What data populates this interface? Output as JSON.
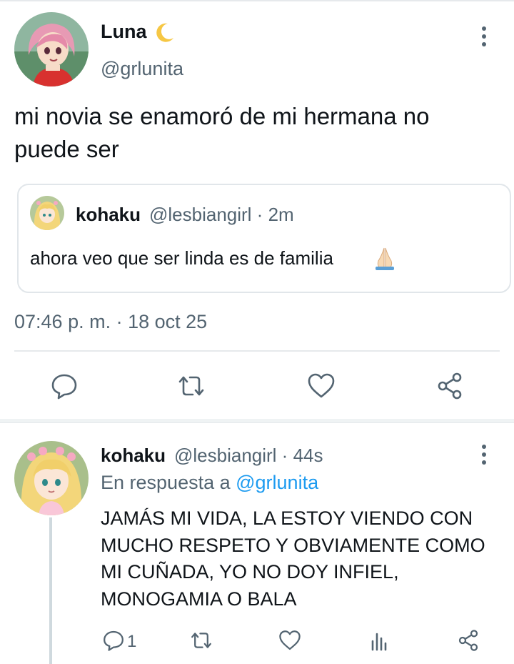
{
  "main_tweet": {
    "author_name": "Luna",
    "author_emoji": "crescent-moon-icon",
    "author_handle": "@grlunita",
    "text": "mi novia se enamoró de mi hermana no puede ser",
    "quoted": {
      "author_name": "kohaku",
      "author_handle": "@lesbiangirl · 2m",
      "text": "ahora veo que ser linda es de familia",
      "emoji": "praying-hands-icon"
    },
    "timestamp": "07:46 p. m. · 18 oct 25",
    "actions": [
      "reply-icon",
      "retweet-icon",
      "like-icon",
      "share-icon"
    ]
  },
  "reply": {
    "author_name": "kohaku",
    "author_handle": "@lesbiangirl · 44s",
    "reply_prefix": "En respuesta a ",
    "reply_mention": "@grlunita",
    "text": "JAMÁS MI VIDA, LA ESTOY VIENDO CON MUCHO RESPETO Y OBVIAMENTE COMO MI CUÑADA, YO NO DOY INFIEL, MONOGAMIA O BALA",
    "reply_count": "1",
    "actions": [
      "reply-icon",
      "retweet-icon",
      "like-icon",
      "views-icon",
      "share-icon"
    ]
  },
  "colors": {
    "text": "#0f1419",
    "secondary": "#536471",
    "link": "#1d9bf0",
    "border": "#e1e6ea"
  }
}
